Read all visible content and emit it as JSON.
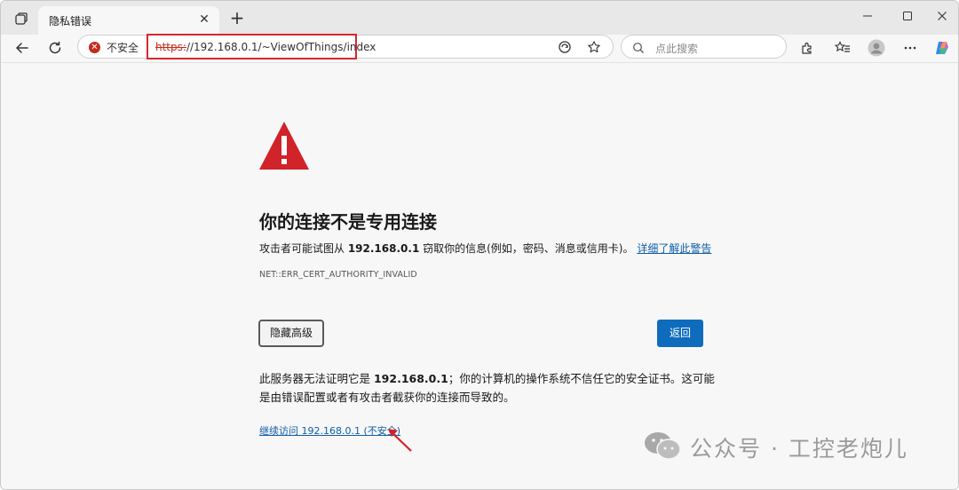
{
  "tab": {
    "title": "隐私错误",
    "close": "✕",
    "new_tab": "+"
  },
  "window_controls": {
    "minimize": "—",
    "maximize": "☐",
    "close": "✕"
  },
  "address_bar": {
    "security_label": "不安全",
    "url_scheme": "https:",
    "url_rest": "//192.168.0.1/~ViewOfThings/index"
  },
  "search": {
    "placeholder": "点此搜索"
  },
  "page": {
    "heading": "你的连接不是专用连接",
    "desc_prefix": "攻击者可能试图从 ",
    "desc_host": "192.168.0.1",
    "desc_suffix": " 窃取你的信息(例如，密码、消息或信用卡)。",
    "learn_more": "详细了解此警告",
    "error_code": "NET::ERR_CERT_AUTHORITY_INVALID",
    "advanced_button": "隐藏高级",
    "back_button": "返回",
    "explain_prefix": "此服务器无法证明它是 ",
    "explain_host": "192.168.0.1",
    "explain_suffix": "；你的计算机的操作系统不信任它的安全证书。这可能是由错误配置或者有攻击者截获你的连接而导致的。",
    "proceed_link": "继续访问 192.168.0.1 (不安全)"
  },
  "watermark": {
    "text": "公众号 · 工控老炮儿"
  },
  "colors": {
    "accent": "#0f6cbd",
    "danger": "#c42b1c",
    "highlight_box": "#d9262c",
    "link": "#0f5ea8"
  }
}
